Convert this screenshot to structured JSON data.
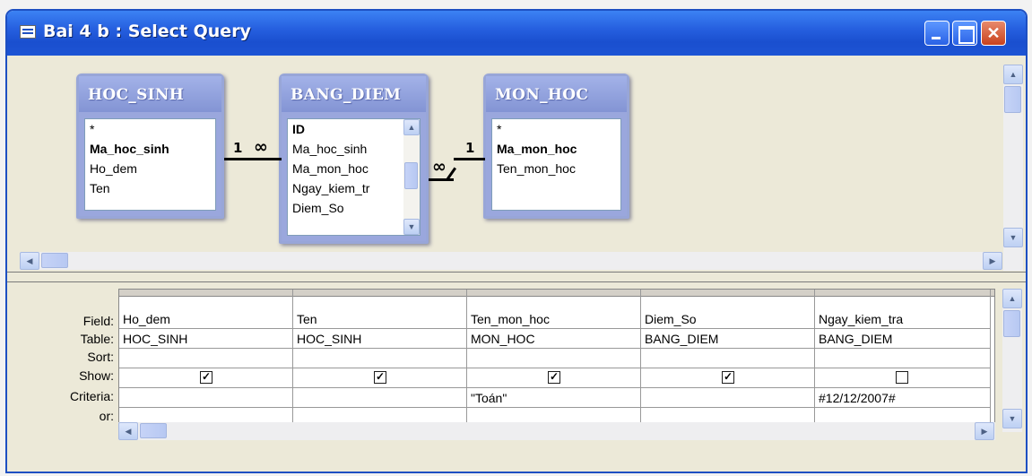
{
  "window": {
    "title": "Bai 4 b : Select Query"
  },
  "tables": [
    {
      "name": "HOC_SINH",
      "fields": [
        {
          "text": "*",
          "bold": false
        },
        {
          "text": "Ma_hoc_sinh",
          "bold": true
        },
        {
          "text": "Ho_dem",
          "bold": false
        },
        {
          "text": "Ten",
          "bold": false
        }
      ]
    },
    {
      "name": "BANG_DIEM",
      "fields": [
        {
          "text": "ID",
          "bold": true
        },
        {
          "text": "Ma_hoc_sinh",
          "bold": false
        },
        {
          "text": "Ma_mon_hoc",
          "bold": false
        },
        {
          "text": "Ngay_kiem_tr",
          "bold": false
        },
        {
          "text": "Diem_So",
          "bold": false
        }
      ]
    },
    {
      "name": "MON_HOC",
      "fields": [
        {
          "text": "*",
          "bold": false
        },
        {
          "text": "Ma_mon_hoc",
          "bold": true
        },
        {
          "text": "Ten_mon_hoc",
          "bold": false
        }
      ]
    }
  ],
  "relations": [
    {
      "left": "1",
      "right": "∞"
    },
    {
      "left": "∞",
      "right": "1"
    }
  ],
  "grid": {
    "row_labels": [
      "Field:",
      "Table:",
      "Sort:",
      "Show:",
      "Criteria:",
      "or:"
    ],
    "columns": [
      {
        "field": "Ho_dem",
        "table": "HOC_SINH",
        "sort": "",
        "show": true,
        "criteria": "",
        "or": ""
      },
      {
        "field": "Ten",
        "table": "HOC_SINH",
        "sort": "",
        "show": true,
        "criteria": "",
        "or": ""
      },
      {
        "field": "Ten_mon_hoc",
        "table": "MON_HOC",
        "sort": "",
        "show": true,
        "criteria": "\"Toán\"",
        "or": ""
      },
      {
        "field": "Diem_So",
        "table": "BANG_DIEM",
        "sort": "",
        "show": true,
        "criteria": "",
        "or": ""
      },
      {
        "field": "Ngay_kiem_tra",
        "table": "BANG_DIEM",
        "sort": "",
        "show": false,
        "criteria": "#12/12/2007#",
        "or": ""
      }
    ]
  },
  "colors": {
    "titlebar": "#2660e0",
    "table_header": "#8394d4",
    "window_bg": "#ece9d8"
  },
  "icons": [
    "query-window-icon",
    "minimize-icon",
    "maximize-icon",
    "close-icon",
    "scroll-up-icon",
    "scroll-down-icon",
    "scroll-left-icon",
    "scroll-right-icon",
    "checkbox-icon"
  ]
}
